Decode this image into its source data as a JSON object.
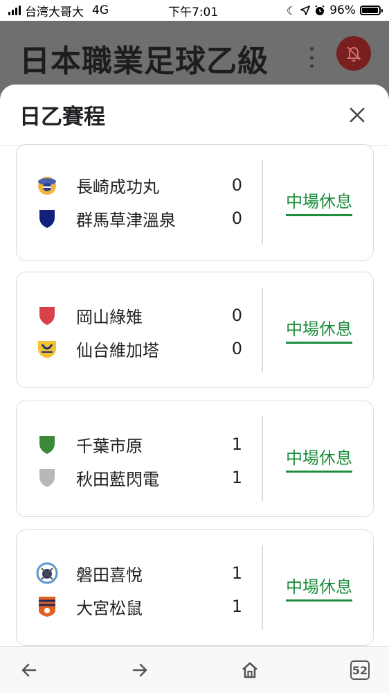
{
  "status_bar": {
    "carrier": "台湾大哥大",
    "network": "4G",
    "time": "下午7:01",
    "battery": "96%",
    "battery_level": 0.96
  },
  "background_page": {
    "title": "日本職業足球乙級"
  },
  "sheet": {
    "title": "日乙賽程",
    "matches": [
      {
        "home": {
          "name": "長崎成功丸",
          "score": "0",
          "logo": "nagasaki-crest-icon",
          "color": "#e8a020"
        },
        "away": {
          "name": "群馬草津溫泉",
          "score": "0",
          "logo": "gunma-shield-icon",
          "color": "#14217a"
        },
        "status": "中場休息"
      },
      {
        "home": {
          "name": "岡山綠雉",
          "score": "0",
          "logo": "okayama-shield-icon",
          "color": "#d9414a"
        },
        "away": {
          "name": "仙台維加塔",
          "score": "0",
          "logo": "sendai-crest-icon",
          "color": "#f0c020"
        },
        "status": "中場休息"
      },
      {
        "home": {
          "name": "千葉市原",
          "score": "1",
          "logo": "chiba-shield-icon",
          "color": "#3a8a3a"
        },
        "away": {
          "name": "秋田藍閃電",
          "score": "1",
          "logo": "akita-shield-icon",
          "color": "#b8b8b8"
        },
        "status": "中場休息"
      },
      {
        "home": {
          "name": "磐田喜悅",
          "score": "1",
          "logo": "iwata-crest-icon",
          "color": "#6fa8dc"
        },
        "away": {
          "name": "大宮松鼠",
          "score": "1",
          "logo": "omiya-crest-icon",
          "color": "#e06020"
        },
        "status": "中場休息"
      }
    ]
  },
  "bottom_nav": {
    "tabs_count": "52"
  },
  "colors": {
    "accent_green": "#1e8e3e",
    "overlay": "#6f6f6f"
  }
}
